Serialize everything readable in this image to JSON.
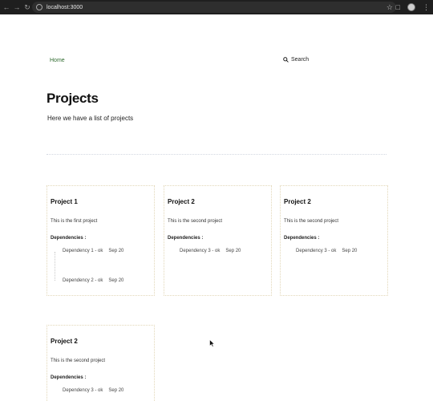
{
  "browser": {
    "url": "localhost:3000"
  },
  "nav": {
    "home_label": "Home",
    "search_label": "Search"
  },
  "header": {
    "title": "Projects",
    "subtitle": "Here we have a list of projects"
  },
  "deps_label": "Dependencies :",
  "projects": [
    {
      "title": "Project 1",
      "description": "This is the first project",
      "dependencies": [
        {
          "label": "Dependency 1 - ok",
          "date": "Sep 20"
        },
        {
          "label": "Dependency 2 - ok",
          "date": "Sep 20"
        }
      ]
    },
    {
      "title": "Project 2",
      "description": "This is the second project",
      "dependencies": [
        {
          "label": "Dependency 3 - ok",
          "date": "Sep 20"
        }
      ]
    },
    {
      "title": "Project 2",
      "description": "This is the second project",
      "dependencies": [
        {
          "label": "Dependency 3 - ok",
          "date": "Sep 20"
        }
      ]
    },
    {
      "title": "Project 2",
      "description": "This is the second project",
      "dependencies": [
        {
          "label": "Dependency 3 - ok",
          "date": "Sep 20"
        }
      ]
    }
  ]
}
